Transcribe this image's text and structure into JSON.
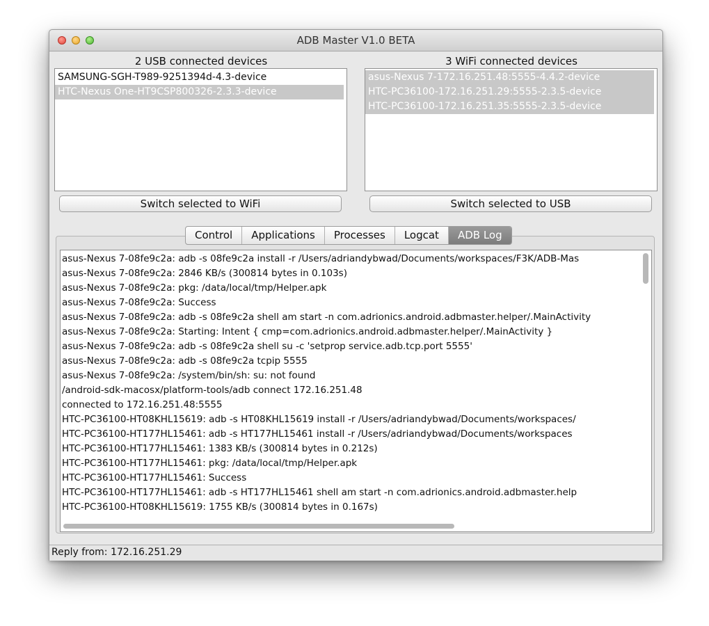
{
  "window": {
    "title": "ADB Master V1.0 BETA"
  },
  "usb": {
    "label": "2 USB connected devices",
    "devices": [
      "SAMSUNG-SGH-T989-9251394d-4.3-device",
      "HTC-Nexus One-HT9CSP800326-2.3.3-device"
    ],
    "switch_button": "Switch selected to WiFi"
  },
  "wifi": {
    "label": "3 WiFi connected devices",
    "devices": [
      "asus-Nexus 7-172.16.251.48:5555-4.4.2-device",
      "HTC-PC36100-172.16.251.29:5555-2.3.5-device",
      "HTC-PC36100-172.16.251.35:5555-2.3.5-device"
    ],
    "switch_button": "Switch selected to USB"
  },
  "tabs": [
    "Control",
    "Applications",
    "Processes",
    "Logcat",
    "ADB Log"
  ],
  "active_tab": "ADB Log",
  "log": [
    "asus-Nexus 7-08fe9c2a:  adb -s 08fe9c2a install -r /Users/adriandybwad/Documents/workspaces/F3K/ADB-Mas",
    "asus-Nexus 7-08fe9c2a: 2846 KB/s (300814 bytes in 0.103s)",
    "asus-Nexus 7-08fe9c2a:  pkg: /data/local/tmp/Helper.apk",
    "asus-Nexus 7-08fe9c2a: Success",
    "asus-Nexus 7-08fe9c2a:  adb -s 08fe9c2a shell am start -n com.adrionics.android.adbmaster.helper/.MainActivity",
    "asus-Nexus 7-08fe9c2a: Starting: Intent { cmp=com.adrionics.android.adbmaster.helper/.MainActivity }",
    "asus-Nexus 7-08fe9c2a:  adb -s 08fe9c2a shell su -c 'setprop service.adb.tcp.port 5555'",
    "asus-Nexus 7-08fe9c2a:  adb -s 08fe9c2a tcpip 5555",
    "asus-Nexus 7-08fe9c2a: /system/bin/sh: su: not found",
    " /android-sdk-macosx/platform-tools/adb connect 172.16.251.48",
    "connected to 172.16.251.48:5555",
    "HTC-PC36100-HT08KHL15619:  adb -s HT08KHL15619 install -r /Users/adriandybwad/Documents/workspaces/",
    "HTC-PC36100-HT177HL15461:  adb -s HT177HL15461 install -r /Users/adriandybwad/Documents/workspaces",
    "HTC-PC36100-HT177HL15461: 1383 KB/s (300814 bytes in 0.212s)",
    "HTC-PC36100-HT177HL15461:  pkg: /data/local/tmp/Helper.apk",
    "HTC-PC36100-HT177HL15461: Success",
    "HTC-PC36100-HT177HL15461:  adb -s HT177HL15461 shell am start -n com.adrionics.android.adbmaster.help",
    "HTC-PC36100-HT08KHL15619: 1755 KB/s (300814 bytes in 0.167s)"
  ],
  "status": "Reply from: 172.16.251.29",
  "colors": {
    "selection": "#c8c8c8",
    "active_tab": "#8a8a8a"
  }
}
